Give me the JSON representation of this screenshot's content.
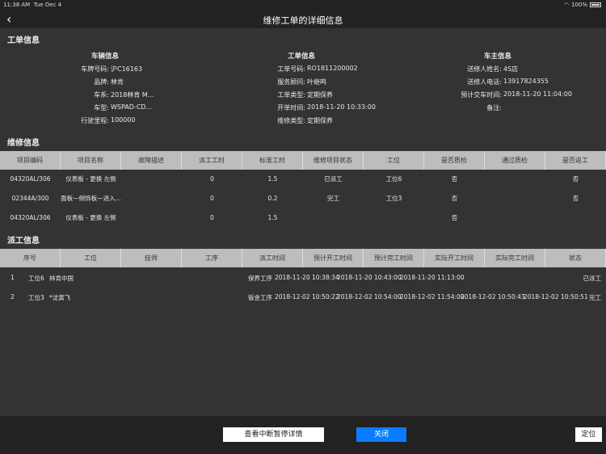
{
  "status": {
    "time": "11:38 AM",
    "date": "Tue Dec 4",
    "battery": "100%"
  },
  "nav": {
    "title": "维修工单的详细信息"
  },
  "sections": {
    "order_info": "工单信息",
    "repair_info": "维修信息",
    "dispatch_info": "派工信息"
  },
  "vehicle": {
    "heading": "车辆信息",
    "rows": [
      {
        "label": "车牌号码:",
        "value": "沪C16163"
      },
      {
        "label": "品牌:",
        "value": "林肯"
      },
      {
        "label": "车系:",
        "value": "2018林肯 M..."
      },
      {
        "label": "车型:",
        "value": "WSPAD-CD..."
      },
      {
        "label": "行驶里程:",
        "value": "100000"
      }
    ]
  },
  "order": {
    "heading": "工单信息",
    "rows": [
      {
        "label": "工单号码:",
        "value": "RO1811200002"
      },
      {
        "label": "服务顾问:",
        "value": "叶继鸣"
      },
      {
        "label": "工单类型:",
        "value": "定期保养"
      },
      {
        "label": "开单时间:",
        "value": "2018-11-20 10:33:00"
      },
      {
        "label": "维修类型:",
        "value": "定期保养"
      }
    ]
  },
  "owner": {
    "heading": "车主信息",
    "rows": [
      {
        "label": "送修人姓名:",
        "value": "4S店"
      },
      {
        "label": "送修人电话:",
        "value": "13917824355"
      },
      {
        "label": "预计交车时间:",
        "value": "2018-11-20 11:04:00"
      },
      {
        "label": "备注:",
        "value": ""
      }
    ]
  },
  "repair_table": {
    "headers": [
      "项目编码",
      "项目名称",
      "故障描述",
      "派工工时",
      "标准工时",
      "维修项目状态",
      "工位",
      "是否质检",
      "通过质检",
      "是否返工"
    ],
    "rows": [
      [
        "04320AL/306",
        "仪表板 - 更换 左侧",
        "",
        "0",
        "1.5",
        "已派工",
        "工位6",
        "否",
        "",
        "否"
      ],
      [
        "02344A/300",
        "面板—侧饰板—进入...",
        "",
        "0",
        "0.2",
        "完工",
        "工位3",
        "否",
        "",
        "否"
      ],
      [
        "04320AL/306",
        "仪表板 - 更换 左侧",
        "",
        "0",
        "1.5",
        "",
        "",
        "否",
        "",
        ""
      ]
    ]
  },
  "dispatch_table": {
    "headers": [
      "序号",
      "工位",
      "技师",
      "工序",
      "派工时间",
      "预计开工时间",
      "预计完工时间",
      "实际开工时间",
      "实际完工时间",
      "状态"
    ],
    "rows": [
      [
        "1",
        "工位6",
        "林肯中国",
        "保养工序",
        "2018-11-20 10:38:34",
        "2018-11-20 10:43:00",
        "2018-11-20 11:13:00",
        "",
        "",
        "已派工"
      ],
      [
        "2",
        "工位3",
        "*沈寅飞",
        "钣金工序",
        "2018-12-02 10:50:22",
        "2018-12-02 10:54:00",
        "2018-12-02 11:54:00",
        "2018-12-02 10:50:43",
        "2018-12-02 10:50:51",
        "完工"
      ]
    ]
  },
  "footer": {
    "view_pause": "查看中断暂停详情",
    "close": "关闭",
    "locate": "定位"
  }
}
